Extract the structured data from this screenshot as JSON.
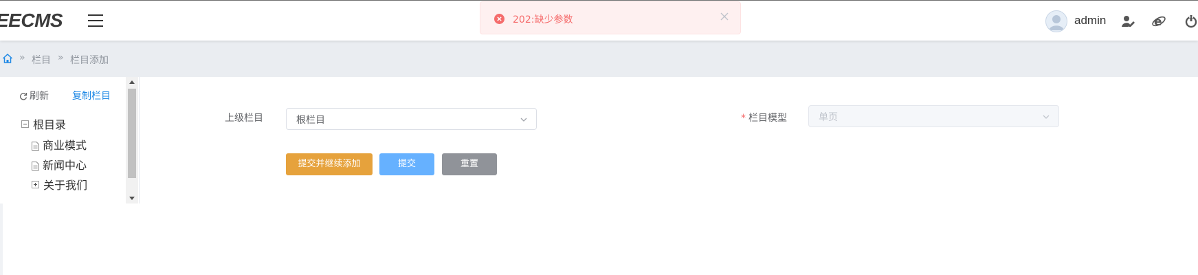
{
  "header": {
    "logo": "EECMS",
    "username": "admin",
    "icons": [
      "menu-icon",
      "avatar",
      "user-edit-icon",
      "browser-ie-icon",
      "power-icon"
    ]
  },
  "toast": {
    "message": "202:缺少参数",
    "type": "error",
    "color": "#f56c6c"
  },
  "breadcrumb": {
    "items": [
      "栏目",
      "栏目添加"
    ],
    "separator": "»"
  },
  "sidebar": {
    "refresh_label": "刷新",
    "copy_label": "复制栏目",
    "tree": {
      "root": "根目录",
      "children": [
        "商业模式",
        "新闻中心",
        "关于我们"
      ]
    }
  },
  "form": {
    "parent_label": "上级栏目",
    "parent_value": "根栏目",
    "model_label": "栏目模型",
    "model_required_mark": "*",
    "model_value": "单页",
    "model_disabled": true
  },
  "buttons": {
    "submit_continue": "提交并继续添加",
    "submit": "提交",
    "reset": "重置"
  },
  "colors": {
    "accent_orange": "#e6a23c",
    "accent_blue": "#66b1ff",
    "neutral_gray": "#909399",
    "link_blue": "#1e88e5"
  }
}
